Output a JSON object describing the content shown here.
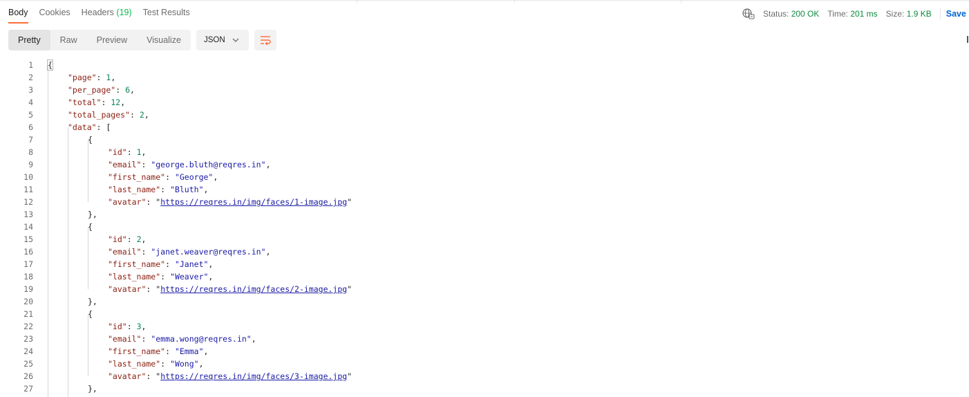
{
  "tabs": [
    {
      "label": "Body",
      "active": true
    },
    {
      "label": "Cookies"
    },
    {
      "label": "Headers",
      "count": "(19)"
    },
    {
      "label": "Test Results"
    }
  ],
  "status": {
    "status_label": "Status:",
    "status_value": "200 OK",
    "time_label": "Time:",
    "time_value": "201 ms",
    "size_label": "Size:",
    "size_value": "1.9 KB",
    "save_label": "Save Re"
  },
  "views": [
    "Pretty",
    "Raw",
    "Preview",
    "Visualize"
  ],
  "language": "JSON",
  "icons": {
    "network": "globe-network-icon",
    "dropdown": "chevron-down-icon",
    "wrap": "wrap-lines-icon"
  },
  "colors": {
    "accent": "#ff6c37",
    "status_ok": "#0c8a3e",
    "link": "#0265d2"
  },
  "code_lines": [
    {
      "n": "1",
      "indent": 0,
      "open": "{",
      "cursor": true
    },
    {
      "n": "2",
      "indent": 1,
      "key": "\"page\"",
      "num": "1",
      "punct": ","
    },
    {
      "n": "3",
      "indent": 1,
      "key": "\"per_page\"",
      "num": "6",
      "punct": ","
    },
    {
      "n": "4",
      "indent": 1,
      "key": "\"total\"",
      "num": "12",
      "punct": ","
    },
    {
      "n": "5",
      "indent": 1,
      "key": "\"total_pages\"",
      "num": "2",
      "punct": ","
    },
    {
      "n": "6",
      "indent": 1,
      "key": "\"data\"",
      "open": "["
    },
    {
      "n": "7",
      "indent": 2,
      "open": "{"
    },
    {
      "n": "8",
      "indent": 3,
      "key": "\"id\"",
      "num": "1",
      "punct": ","
    },
    {
      "n": "9",
      "indent": 3,
      "key": "\"email\"",
      "str": "\"george.bluth@reqres.in\"",
      "punct": ","
    },
    {
      "n": "10",
      "indent": 3,
      "key": "\"first_name\"",
      "str": "\"George\"",
      "punct": ","
    },
    {
      "n": "11",
      "indent": 3,
      "key": "\"last_name\"",
      "str": "\"Bluth\"",
      "punct": ","
    },
    {
      "n": "12",
      "indent": 3,
      "key": "\"avatar\"",
      "url": "https://reqres.in/img/faces/1-image.jpg"
    },
    {
      "n": "13",
      "indent": 2,
      "open": "},"
    },
    {
      "n": "14",
      "indent": 2,
      "open": "{"
    },
    {
      "n": "15",
      "indent": 3,
      "key": "\"id\"",
      "num": "2",
      "punct": ","
    },
    {
      "n": "16",
      "indent": 3,
      "key": "\"email\"",
      "str": "\"janet.weaver@reqres.in\"",
      "punct": ","
    },
    {
      "n": "17",
      "indent": 3,
      "key": "\"first_name\"",
      "str": "\"Janet\"",
      "punct": ","
    },
    {
      "n": "18",
      "indent": 3,
      "key": "\"last_name\"",
      "str": "\"Weaver\"",
      "punct": ","
    },
    {
      "n": "19",
      "indent": 3,
      "key": "\"avatar\"",
      "url": "https://reqres.in/img/faces/2-image.jpg"
    },
    {
      "n": "20",
      "indent": 2,
      "open": "},"
    },
    {
      "n": "21",
      "indent": 2,
      "open": "{"
    },
    {
      "n": "22",
      "indent": 3,
      "key": "\"id\"",
      "num": "3",
      "punct": ","
    },
    {
      "n": "23",
      "indent": 3,
      "key": "\"email\"",
      "str": "\"emma.wong@reqres.in\"",
      "punct": ","
    },
    {
      "n": "24",
      "indent": 3,
      "key": "\"first_name\"",
      "str": "\"Emma\"",
      "punct": ","
    },
    {
      "n": "25",
      "indent": 3,
      "key": "\"last_name\"",
      "str": "\"Wong\"",
      "punct": ","
    },
    {
      "n": "26",
      "indent": 3,
      "key": "\"avatar\"",
      "url": "https://reqres.in/img/faces/3-image.jpg"
    },
    {
      "n": "27",
      "indent": 2,
      "open": "},"
    }
  ]
}
